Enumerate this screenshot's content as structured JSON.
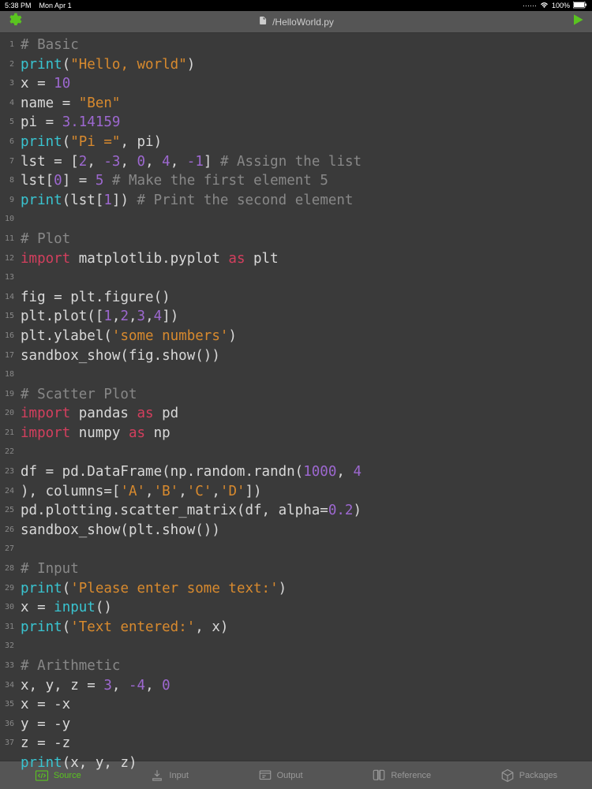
{
  "status": {
    "time": "5:38 PM",
    "date": "Mon Apr 1",
    "wifi": "●●●●",
    "battery": "100%"
  },
  "header": {
    "filename": "/HelloWorld.py"
  },
  "code_lines": [
    [
      [
        "comment",
        "# Basic"
      ]
    ],
    [
      [
        "keyword",
        "print"
      ],
      [
        "op",
        "("
      ],
      [
        "string",
        "\"Hello, world\""
      ],
      [
        "op",
        ")"
      ]
    ],
    [
      [
        "ident",
        "x "
      ],
      [
        "op",
        "= "
      ],
      [
        "number",
        "10"
      ]
    ],
    [
      [
        "ident",
        "name "
      ],
      [
        "op",
        "= "
      ],
      [
        "string",
        "\"Ben\""
      ]
    ],
    [
      [
        "ident",
        "pi "
      ],
      [
        "op",
        "= "
      ],
      [
        "number",
        "3.14159"
      ]
    ],
    [
      [
        "keyword",
        "print"
      ],
      [
        "op",
        "("
      ],
      [
        "string",
        "\"Pi =\""
      ],
      [
        "op",
        ", pi)"
      ]
    ],
    [
      [
        "ident",
        "lst "
      ],
      [
        "op",
        "= ["
      ],
      [
        "number",
        "2"
      ],
      [
        "op",
        ", "
      ],
      [
        "number",
        "-3"
      ],
      [
        "op",
        ", "
      ],
      [
        "number",
        "0"
      ],
      [
        "op",
        ", "
      ],
      [
        "number",
        "4"
      ],
      [
        "op",
        ", "
      ],
      [
        "number",
        "-1"
      ],
      [
        "op",
        "] "
      ],
      [
        "comment",
        "# Assign the list"
      ]
    ],
    [
      [
        "ident",
        "lst"
      ],
      [
        "op",
        "["
      ],
      [
        "number",
        "0"
      ],
      [
        "op",
        "] = "
      ],
      [
        "number",
        "5"
      ],
      [
        "op",
        " "
      ],
      [
        "comment",
        "# Make the first element 5"
      ]
    ],
    [
      [
        "keyword",
        "print"
      ],
      [
        "op",
        "(lst["
      ],
      [
        "number",
        "1"
      ],
      [
        "op",
        "]) "
      ],
      [
        "comment",
        "# Print the second element"
      ]
    ],
    [],
    [
      [
        "comment",
        "# Plot"
      ]
    ],
    [
      [
        "import",
        "import"
      ],
      [
        "ident",
        " matplotlib.pyplot "
      ],
      [
        "as",
        "as"
      ],
      [
        "ident",
        " plt"
      ]
    ],
    [],
    [
      [
        "ident",
        "fig "
      ],
      [
        "op",
        "= plt.figure()"
      ]
    ],
    [
      [
        "ident",
        "plt.plot(["
      ],
      [
        "number",
        "1"
      ],
      [
        "op",
        ","
      ],
      [
        "number",
        "2"
      ],
      [
        "op",
        ","
      ],
      [
        "number",
        "3"
      ],
      [
        "op",
        ","
      ],
      [
        "number",
        "4"
      ],
      [
        "op",
        "])"
      ]
    ],
    [
      [
        "ident",
        "plt.ylabel("
      ],
      [
        "string",
        "'some numbers'"
      ],
      [
        "op",
        ")"
      ]
    ],
    [
      [
        "ident",
        "sandbox_show(fig.show())"
      ]
    ],
    [],
    [
      [
        "comment",
        "# Scatter Plot"
      ]
    ],
    [
      [
        "import",
        "import"
      ],
      [
        "ident",
        " pandas "
      ],
      [
        "as",
        "as"
      ],
      [
        "ident",
        " pd"
      ]
    ],
    [
      [
        "import",
        "import"
      ],
      [
        "ident",
        " numpy "
      ],
      [
        "as",
        "as"
      ],
      [
        "ident",
        " np"
      ]
    ],
    [],
    [
      [
        "ident",
        "df "
      ],
      [
        "op",
        "= pd.DataFrame(np.random.randn("
      ],
      [
        "number",
        "1000"
      ],
      [
        "op",
        ", "
      ],
      [
        "number",
        "4"
      ],
      [
        "op",
        "), columns=["
      ],
      [
        "string",
        "'A'"
      ],
      [
        "op",
        ","
      ],
      [
        "string",
        "'B'"
      ],
      [
        "op",
        ","
      ],
      [
        "string",
        "'C'"
      ],
      [
        "op",
        ","
      ],
      [
        "string",
        "'D'"
      ],
      [
        "op",
        "])"
      ]
    ],
    [
      [
        "ident",
        "pd.plotting.scatter_matrix(df, alpha="
      ],
      [
        "number",
        "0.2"
      ],
      [
        "op",
        ")"
      ]
    ],
    [
      [
        "ident",
        "sandbox_show(plt.show())"
      ]
    ],
    [],
    [
      [
        "comment",
        "# Input"
      ]
    ],
    [
      [
        "keyword",
        "print"
      ],
      [
        "op",
        "("
      ],
      [
        "string",
        "'Please enter some text:'"
      ],
      [
        "op",
        ")"
      ]
    ],
    [
      [
        "ident",
        "x "
      ],
      [
        "op",
        "= "
      ],
      [
        "keyword",
        "input"
      ],
      [
        "op",
        "()"
      ]
    ],
    [
      [
        "keyword",
        "print"
      ],
      [
        "op",
        "("
      ],
      [
        "string",
        "'Text entered:'"
      ],
      [
        "op",
        ", x)"
      ]
    ],
    [],
    [
      [
        "comment",
        "# Arithmetic"
      ]
    ],
    [
      [
        "ident",
        "x, y, z "
      ],
      [
        "op",
        "= "
      ],
      [
        "number",
        "3"
      ],
      [
        "op",
        ", "
      ],
      [
        "number",
        "-4"
      ],
      [
        "op",
        ", "
      ],
      [
        "number",
        "0"
      ]
    ],
    [
      [
        "ident",
        "x "
      ],
      [
        "op",
        "= -x"
      ]
    ],
    [
      [
        "ident",
        "y "
      ],
      [
        "op",
        "= -y"
      ]
    ],
    [
      [
        "ident",
        "z "
      ],
      [
        "op",
        "= -z"
      ]
    ],
    [
      [
        "keyword",
        "print"
      ],
      [
        "op",
        "(x, y, z)"
      ]
    ]
  ],
  "line_numbers_with_wrap": [
    1,
    2,
    3,
    4,
    5,
    6,
    7,
    8,
    9,
    10,
    11,
    12,
    13,
    14,
    15,
    16,
    17,
    18,
    19,
    20,
    21,
    22,
    23,
    "",
    24,
    25,
    26,
    27,
    28,
    29,
    30,
    31,
    32,
    33,
    34,
    35,
    36,
    37
  ],
  "tabs": {
    "source": "Source",
    "input": "Input",
    "output": "Output",
    "reference": "Reference",
    "packages": "Packages"
  }
}
